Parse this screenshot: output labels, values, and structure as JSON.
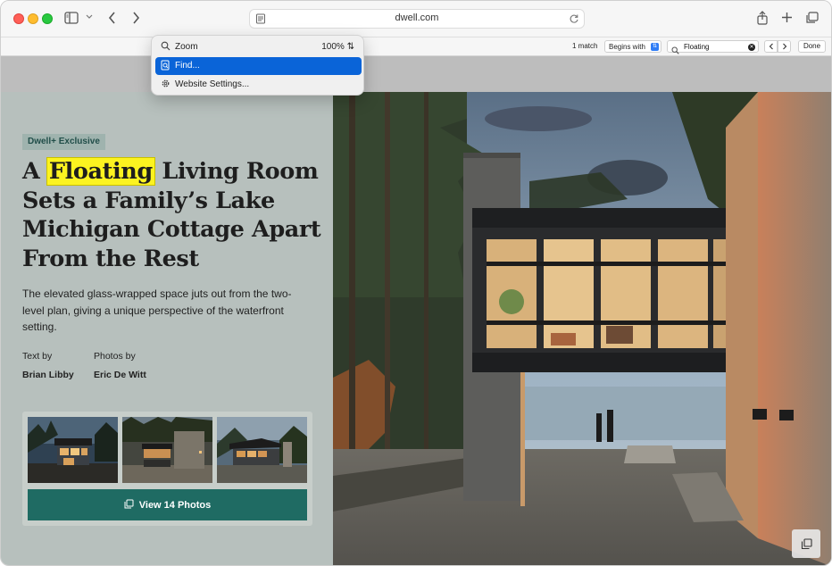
{
  "browser": {
    "url": "dwell.com",
    "icons": [
      "sidebar-icon",
      "chevron-down-icon",
      "back-icon",
      "forward-icon",
      "reader-icon",
      "reload-icon",
      "share-icon",
      "new-tab-icon",
      "tab-overview-icon"
    ]
  },
  "find_bar": {
    "match_count": "1 match",
    "mode": "Begins with",
    "query": "Floating",
    "done_label": "Done"
  },
  "menu": {
    "zoom_label": "Zoom",
    "zoom_value": "100%",
    "find_label": "Find...",
    "settings_label": "Website Settings..."
  },
  "article": {
    "badge": "Dwell+ Exclusive",
    "headline_pre": "A ",
    "headline_highlight": "Floating",
    "headline_post": " Living Room Sets a Family’s Lake Michigan Cottage Apart From the Rest",
    "dek": "The elevated glass-wrapped space juts out from the two-level plan, giving a unique perspective of the waterfront setting.",
    "text_by_label": "Text by",
    "text_by_name": "Brian Libby",
    "photos_by_label": "Photos by",
    "photos_by_name": "Eric De Witt",
    "view_photos_label": "View 14 Photos"
  },
  "colors": {
    "panel_bg": "#b7c0bd",
    "accent": "#1f6b63",
    "highlight": "#fcf320",
    "menu_active": "#0a64d8"
  }
}
